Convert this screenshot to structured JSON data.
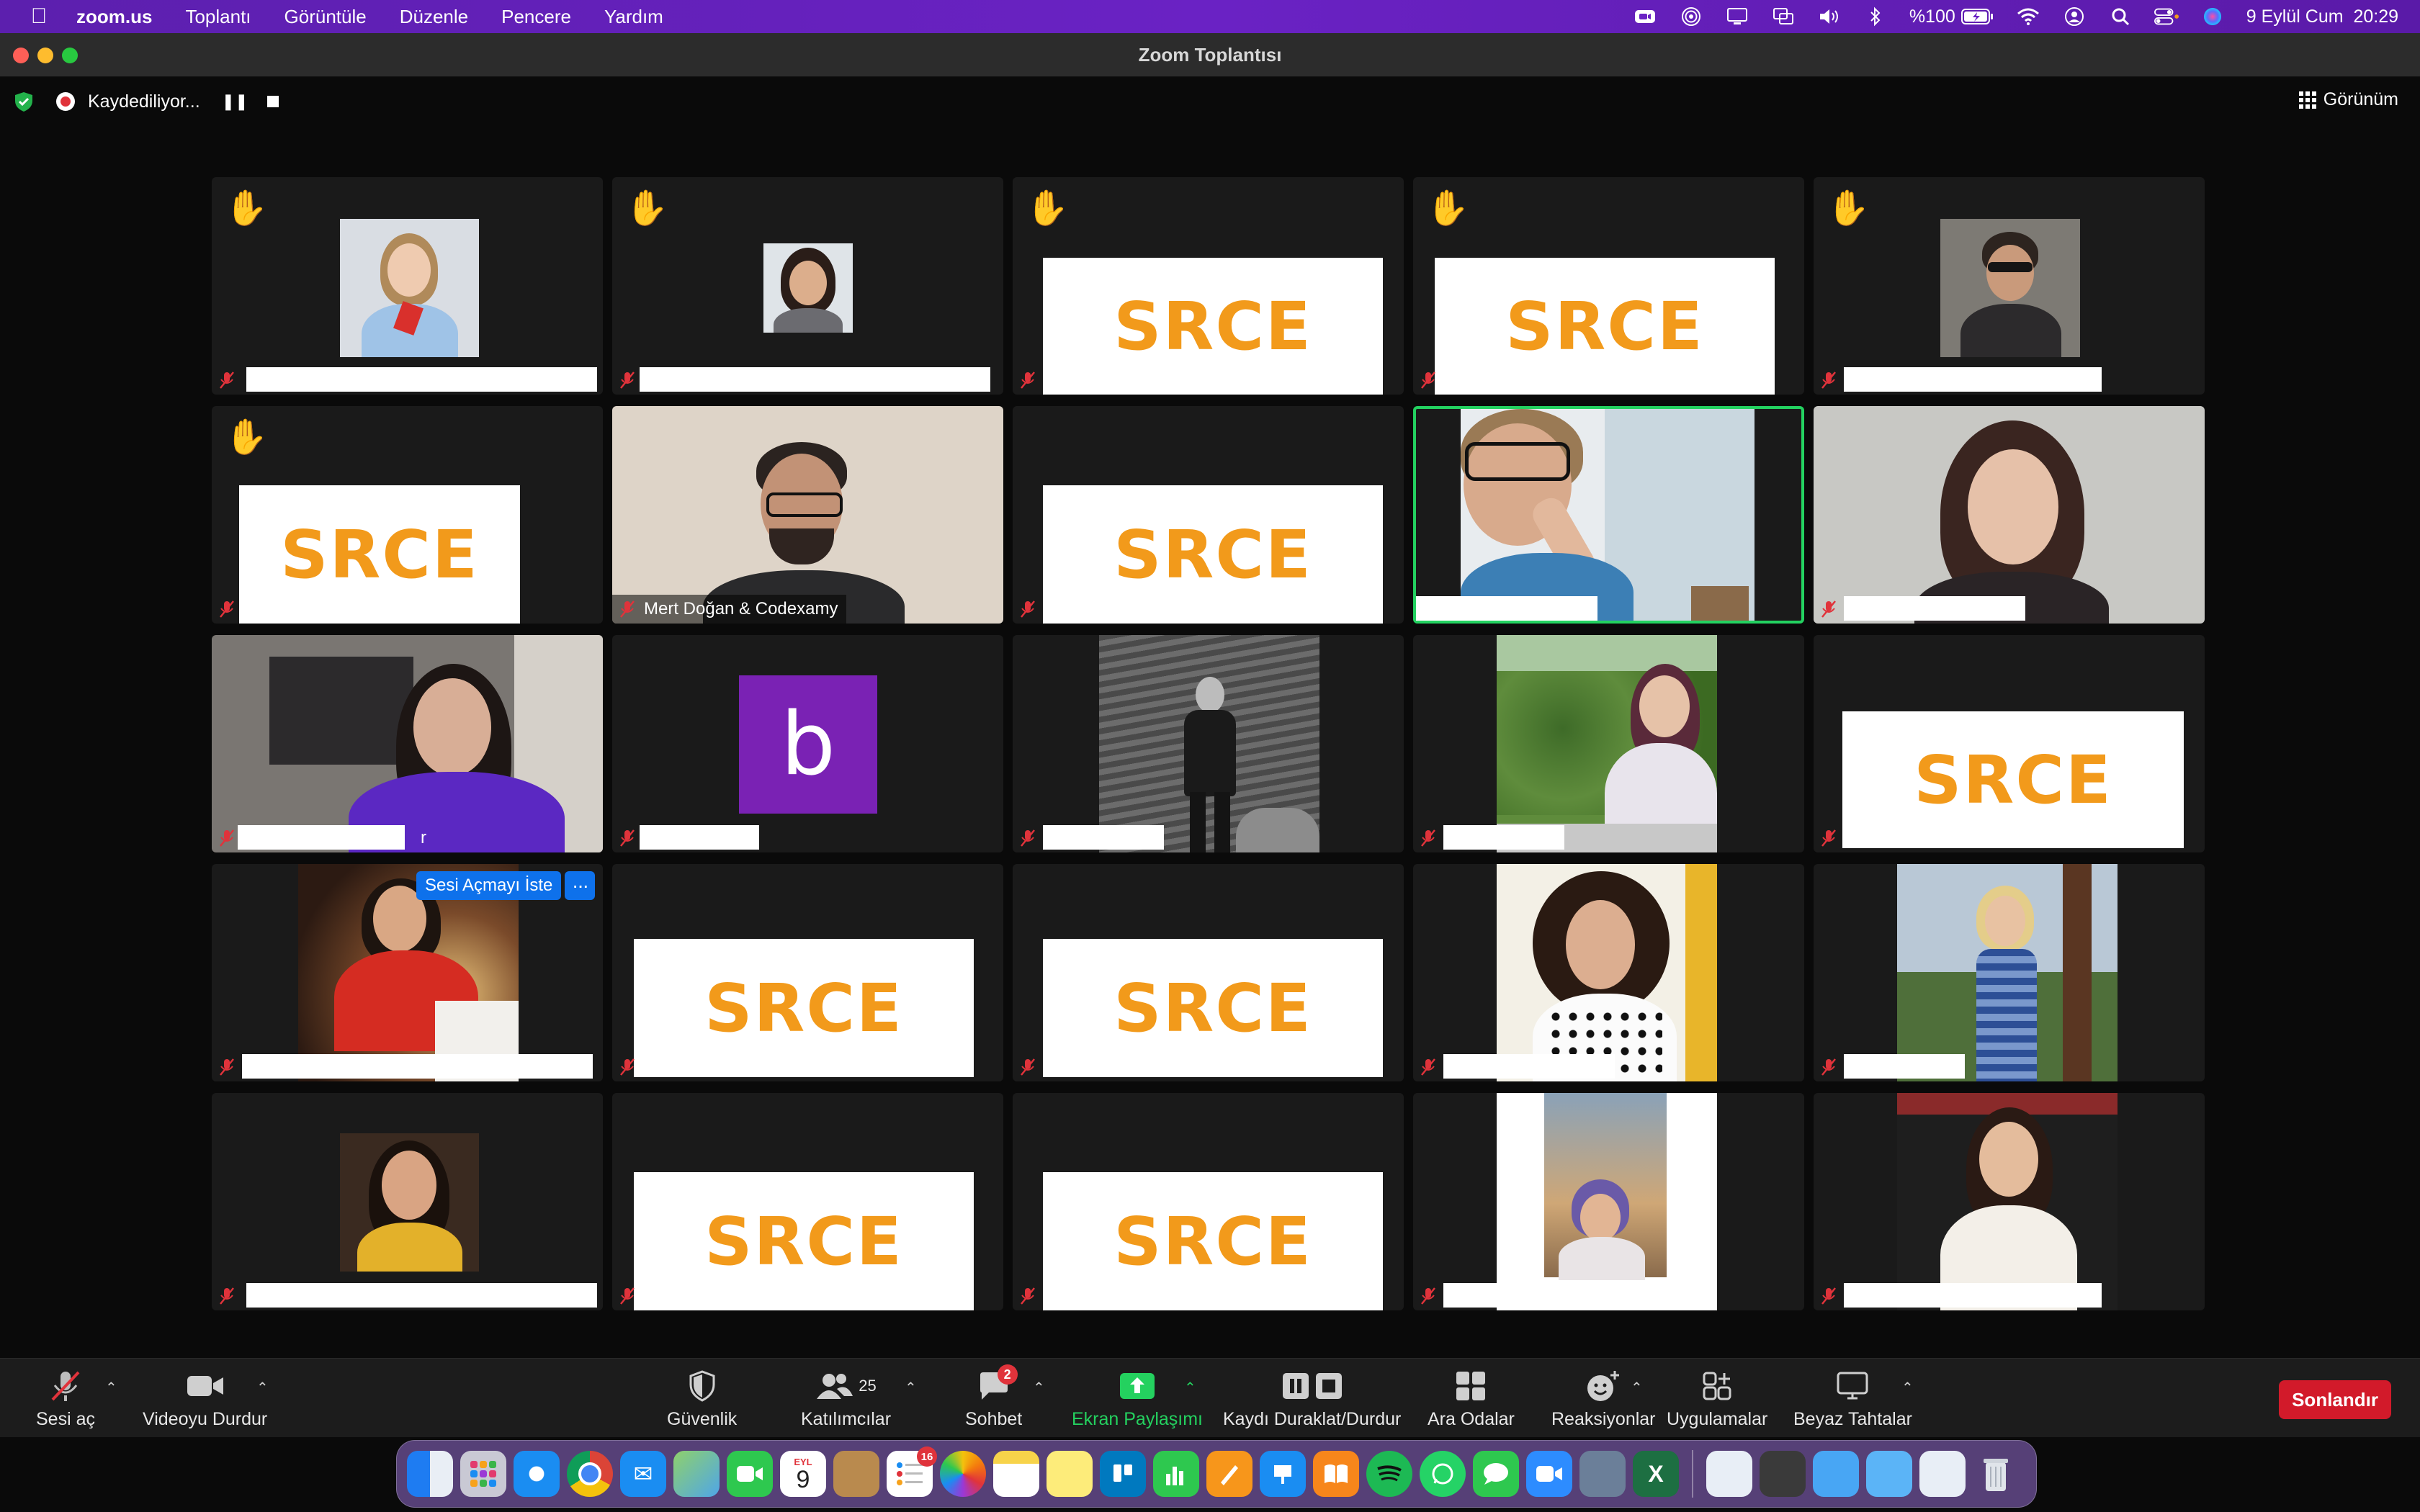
{
  "menubar": {
    "app_name": "zoom.us",
    "menus": [
      "Toplantı",
      "Görüntüle",
      "Düzenle",
      "Pencere",
      "Yardım"
    ],
    "battery": "%100",
    "datetime": "9 Eylül Cum  20:29"
  },
  "window": {
    "title": "Zoom Toplantısı"
  },
  "recording": {
    "label": "Kaydediliyor..."
  },
  "view_button": {
    "label": "Görünüm"
  },
  "tiles": {
    "srce_text": "SRCE",
    "named_participant": "Mert Doğan & Codexamy",
    "letter_avatar": "b",
    "name_fragment": "r"
  },
  "unmute_request": {
    "label": "Sesi Açmayı İste",
    "more": "···"
  },
  "toolbar": {
    "unmute": "Sesi aç",
    "stop_video": "Videoyu Durdur",
    "security": "Güvenlik",
    "participants": "Katılımcılar",
    "participants_count": "25",
    "chat": "Sohbet",
    "chat_badge": "2",
    "share_screen": "Ekran Paylaşımı",
    "pause_recording": "Kaydı Duraklat/Durdur",
    "breakout": "Ara Odalar",
    "reactions": "Reaksiyonlar",
    "apps": "Uygulamalar",
    "whiteboard": "Beyaz Tahtalar",
    "end": "Sonlandır"
  },
  "dock": {
    "calendar_month": "EYL",
    "calendar_day": "9",
    "reminders_badge": "16"
  },
  "colors": {
    "menubar": "#6a22c4",
    "srce_orange": "#f29a1b",
    "active_speaker": "#23d160",
    "share_green": "#24d15f",
    "end_red": "#d21a2a",
    "zoom_blue": "#0e71eb"
  }
}
